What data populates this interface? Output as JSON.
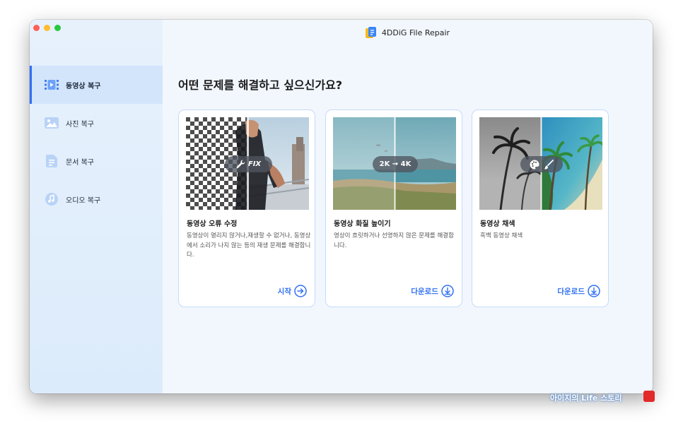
{
  "app": {
    "title": "4DDiG File Repair"
  },
  "sidebar": {
    "items": [
      {
        "label": "동영상 복구",
        "icon": "video-icon",
        "active": true
      },
      {
        "label": "사진 복구",
        "icon": "photo-icon",
        "active": false
      },
      {
        "label": "문서 복구",
        "icon": "document-icon",
        "active": false
      },
      {
        "label": "오디오 복구",
        "icon": "audio-icon",
        "active": false
      }
    ]
  },
  "main": {
    "heading": "어떤 문제를 해결하고 싶으신가요?",
    "cards": [
      {
        "title": "동영상 오류 수정",
        "description": "동영상이 열리지 않거나,재생할 수 없거나, 동영상에서 소리가 나지 않는 등의 재생 문제를 해결합니다.",
        "badge": "FIX",
        "action": "시작",
        "action_icon": "arrow-right-circle-icon"
      },
      {
        "title": "동영상 화질 높이기",
        "description": "영상이 흐릿하거나 선명하지 않은 문제를 해결합니다.",
        "badge": "2K → 4K",
        "action": "다운로드",
        "action_icon": "download-circle-icon"
      },
      {
        "title": "동영상 채색",
        "description": "흑백 동영상 채색",
        "badge": "",
        "action": "다운로드",
        "action_icon": "download-circle-icon"
      }
    ]
  },
  "watermark": {
    "text": "아이지의 Life 스토리"
  },
  "colors": {
    "accent": "#2f6ff3",
    "card_border": "#c5dafa",
    "sidebar_bg": "#e2eefb",
    "main_bg": "#f2f7fe"
  }
}
